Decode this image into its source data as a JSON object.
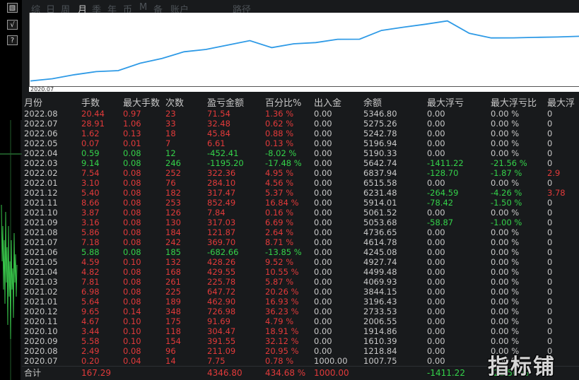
{
  "side_buttons": [
    {
      "icon": "image-icon",
      "glyph": "▧"
    },
    {
      "icon": "check-icon",
      "glyph": "√"
    },
    {
      "icon": "help-icon",
      "glyph": "?"
    }
  ],
  "tabs": [
    {
      "label": "综",
      "active": false
    },
    {
      "label": "日",
      "active": false
    },
    {
      "label": "周",
      "active": false
    },
    {
      "label": "月",
      "active": true
    },
    {
      "label": "季",
      "active": false
    },
    {
      "label": "年",
      "active": false
    },
    {
      "label": "币",
      "active": false
    },
    {
      "label": "M",
      "active": false
    },
    {
      "label": "备",
      "active": false
    },
    {
      "label": "账户",
      "active": false
    },
    {
      "label": "路径",
      "active": false
    }
  ],
  "equity_chart": {
    "x_start_label": "2020.07",
    "line_color": "#2e9ae6",
    "values": [
      1007.75,
      1218.84,
      1610.39,
      1914.86,
      2006.55,
      2733.53,
      3196.43,
      3844.15,
      4069.93,
      4499.48,
      4927.74,
      4245.08,
      4614.78,
      4736.65,
      5053.68,
      5061.52,
      5914.01,
      6231.48,
      6515.58,
      6837.94,
      5642.74,
      5190.33,
      5196.94,
      5242.78,
      5275.26,
      5346.8
    ]
  },
  "table": {
    "headers": [
      "月份",
      "手数",
      "最大手数",
      "次数",
      "盈亏金额",
      "百分比%",
      "出入金",
      "余额",
      "最大浮亏",
      "最大浮亏比",
      "最大浮"
    ],
    "rows": [
      {
        "color": "red",
        "c": [
          "2022.08",
          "20.44",
          "0.97",
          "23",
          "71.54",
          "1.36 %",
          "0.00",
          "5346.80",
          "0.00",
          "0.00 %",
          "0"
        ]
      },
      {
        "color": "red",
        "c": [
          "2022.07",
          "28.91",
          "1.06",
          "33",
          "32.48",
          "0.62 %",
          "0.00",
          "5275.26",
          "0.00",
          "0.00 %",
          "0"
        ]
      },
      {
        "color": "red",
        "c": [
          "2022.06",
          "1.62",
          "0.13",
          "18",
          "45.84",
          "0.88 %",
          "0.00",
          "5242.78",
          "0.00",
          "0.00 %",
          "0"
        ]
      },
      {
        "color": "red",
        "c": [
          "2022.05",
          "0.07",
          "0.01",
          "7",
          "6.61",
          "0.13 %",
          "0.00",
          "5196.94",
          "0.00",
          "0.00 %",
          "0"
        ]
      },
      {
        "color": "green",
        "c": [
          "2022.04",
          "0.59",
          "0.08",
          "12",
          "-452.41",
          "-8.02 %",
          "0.00",
          "5190.33",
          "0.00",
          "0.00 %",
          "0"
        ]
      },
      {
        "color": "green",
        "c": [
          "2022.03",
          "9.14",
          "0.08",
          "246",
          "-1195.20",
          "-17.48 %",
          "0.00",
          "5642.74",
          "-1411.22",
          "-21.56 %",
          "0"
        ]
      },
      {
        "color": "red",
        "c": [
          "2022.02",
          "7.54",
          "0.08",
          "252",
          "322.36",
          "4.95 %",
          "0.00",
          "6837.94",
          "-128.70",
          "-1.87 %",
          "2.9"
        ]
      },
      {
        "color": "red",
        "c": [
          "2022.01",
          "3.10",
          "0.08",
          "76",
          "284.10",
          "4.56 %",
          "0.00",
          "6515.58",
          "0.00",
          "0.00 %",
          "0"
        ]
      },
      {
        "color": "red",
        "c": [
          "2021.12",
          "5.40",
          "0.08",
          "182",
          "317.47",
          "5.37 %",
          "0.00",
          "6231.48",
          "-264.59",
          "-4.26 %",
          "3.78"
        ]
      },
      {
        "color": "red",
        "c": [
          "2021.11",
          "8.66",
          "0.08",
          "253",
          "852.49",
          "16.84 %",
          "0.00",
          "5914.01",
          "-78.42",
          "-1.50 %",
          "0"
        ]
      },
      {
        "color": "red",
        "c": [
          "2021.10",
          "3.87",
          "0.08",
          "126",
          "7.84",
          "0.16 %",
          "0.00",
          "5061.52",
          "0.00",
          "0.00 %",
          "0"
        ]
      },
      {
        "color": "red",
        "c": [
          "2021.09",
          "3.16",
          "0.08",
          "130",
          "317.03",
          "6.69 %",
          "0.00",
          "5053.68",
          "-58.87",
          "-1.00 %",
          "0"
        ]
      },
      {
        "color": "red",
        "c": [
          "2021.08",
          "5.86",
          "0.08",
          "184",
          "121.87",
          "2.64 %",
          "0.00",
          "4736.65",
          "0.00",
          "0.00 %",
          "0"
        ]
      },
      {
        "color": "red",
        "c": [
          "2021.07",
          "7.18",
          "0.08",
          "242",
          "369.70",
          "8.71 %",
          "0.00",
          "4614.78",
          "0.00",
          "0.00 %",
          "0"
        ]
      },
      {
        "color": "green",
        "c": [
          "2021.06",
          "5.88",
          "0.08",
          "185",
          "-682.66",
          "-13.85 %",
          "0.00",
          "4245.08",
          "0.00",
          "0.00 %",
          "0"
        ]
      },
      {
        "color": "red",
        "c": [
          "2021.05",
          "4.59",
          "0.10",
          "132",
          "428.26",
          "9.52 %",
          "0.00",
          "4927.74",
          "0.00",
          "0.00 %",
          "0"
        ]
      },
      {
        "color": "red",
        "c": [
          "2021.04",
          "4.82",
          "0.08",
          "168",
          "429.55",
          "10.55 %",
          "0.00",
          "4499.48",
          "0.00",
          "0.00 %",
          "0"
        ]
      },
      {
        "color": "red",
        "c": [
          "2021.03",
          "7.81",
          "0.08",
          "261",
          "225.78",
          "5.87 %",
          "0.00",
          "4069.93",
          "0.00",
          "0.00 %",
          "0"
        ]
      },
      {
        "color": "red",
        "c": [
          "2021.02",
          "6.98",
          "0.08",
          "225",
          "647.72",
          "20.26 %",
          "0.00",
          "3844.15",
          "0.00",
          "0.00 %",
          "0"
        ]
      },
      {
        "color": "red",
        "c": [
          "2021.01",
          "5.64",
          "0.08",
          "189",
          "462.90",
          "16.93 %",
          "0.00",
          "3196.43",
          "0.00",
          "0.00 %",
          "0"
        ]
      },
      {
        "color": "red",
        "c": [
          "2020.12",
          "9.65",
          "0.14",
          "348",
          "726.98",
          "36.23 %",
          "0.00",
          "2733.53",
          "0.00",
          "0.00 %",
          "0"
        ]
      },
      {
        "color": "red",
        "c": [
          "2020.11",
          "4.67",
          "0.10",
          "175",
          "91.69",
          "4.79 %",
          "0.00",
          "2006.55",
          "0.00",
          "0.00 %",
          "0"
        ]
      },
      {
        "color": "red",
        "c": [
          "2020.10",
          "3.44",
          "0.10",
          "118",
          "304.47",
          "18.91 %",
          "0.00",
          "1914.86",
          "0.00",
          "0.00 %",
          "0"
        ]
      },
      {
        "color": "red",
        "c": [
          "2020.09",
          "5.58",
          "0.10",
          "154",
          "391.55",
          "32.12 %",
          "0.00",
          "1610.39",
          "0.00",
          "0.00 %",
          "0"
        ]
      },
      {
        "color": "red",
        "c": [
          "2020.08",
          "2.49",
          "0.08",
          "96",
          "211.09",
          "20.95 %",
          "0.00",
          "1218.84",
          "0.00",
          "0.00 %",
          "0"
        ]
      },
      {
        "color": "red",
        "c": [
          "2020.07",
          "0.20",
          "0.04",
          "14",
          "7.75",
          "0.78 %",
          "1000.00",
          "1007.75",
          "0.00",
          "0.00 %",
          "0"
        ]
      }
    ],
    "total": {
      "label": "合计",
      "c": [
        "合计",
        "167.29",
        "",
        "",
        "4346.80",
        "434.68 %",
        "1000.00",
        "",
        "-1411.22",
        "-21.56 %",
        ""
      ]
    }
  },
  "watermark": "指标铺",
  "colors": {
    "up": "#e23a3a",
    "down": "#34d24a",
    "text": "#c8c8c8",
    "panel_bg": "#181a1c",
    "tab_inactive": "#4d5257"
  }
}
